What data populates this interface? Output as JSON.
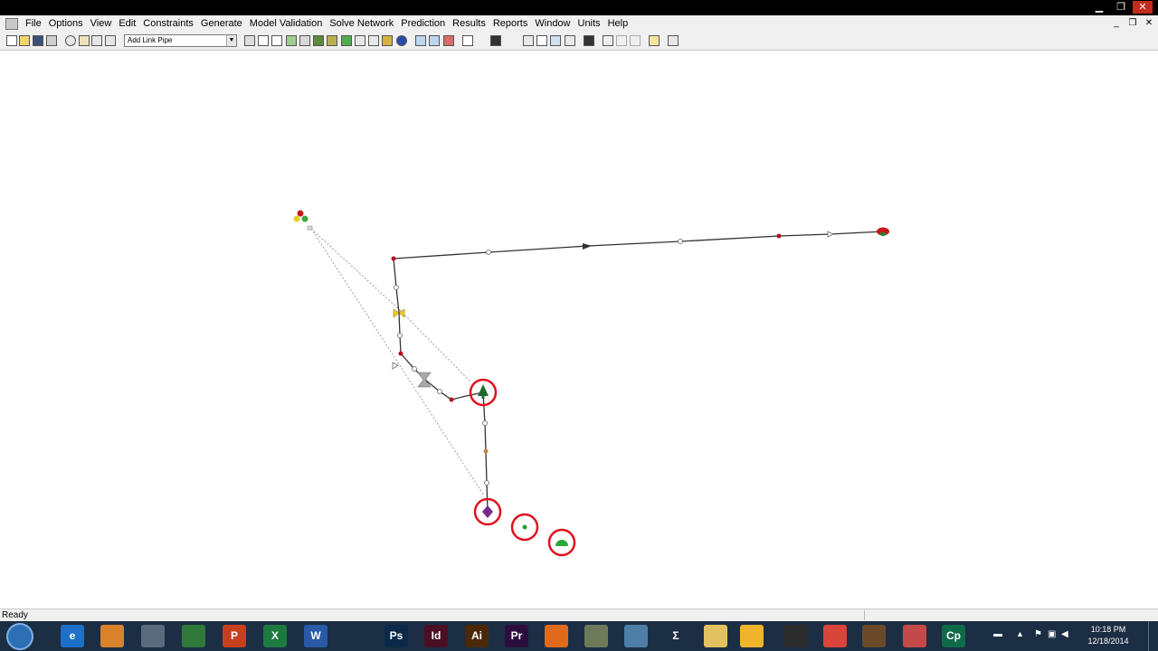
{
  "menu": {
    "items": [
      "File",
      "Options",
      "View",
      "Edit",
      "Constraints",
      "Generate",
      "Model Validation",
      "Solve Network",
      "Prediction",
      "Results",
      "Reports",
      "Window",
      "Units",
      "Help"
    ]
  },
  "toolbar": {
    "link_type": "Add Link Pipe"
  },
  "status": {
    "text": "Ready"
  },
  "taskbar": {
    "apps": [
      {
        "name": "internet-explorer",
        "label": "e",
        "color": "#1e6fc7"
      },
      {
        "name": "file-app",
        "label": "",
        "color": "#d9822b"
      },
      {
        "name": "tools",
        "label": "",
        "color": "#5a6b7d"
      },
      {
        "name": "network-app",
        "label": "",
        "color": "#2f7a3a"
      },
      {
        "name": "powerpoint",
        "label": "P",
        "color": "#c6401f"
      },
      {
        "name": "excel",
        "label": "X",
        "color": "#1d7a3f"
      },
      {
        "name": "word",
        "label": "W",
        "color": "#2a5aa7"
      },
      {
        "name": "moon-app",
        "label": "",
        "color": "#1c2e44"
      },
      {
        "name": "photoshop",
        "label": "Ps",
        "color": "#0b2a4a"
      },
      {
        "name": "indesign",
        "label": "Id",
        "color": "#4a0f24"
      },
      {
        "name": "illustrator",
        "label": "Ai",
        "color": "#4a2a06"
      },
      {
        "name": "premiere",
        "label": "Pr",
        "color": "#2c0e3e"
      },
      {
        "name": "firefox",
        "label": "",
        "color": "#e06a1b"
      },
      {
        "name": "app-diamond",
        "label": "",
        "color": "#6c7a5a"
      },
      {
        "name": "app-book",
        "label": "",
        "color": "#4f7fa8"
      },
      {
        "name": "sigma-app",
        "label": "Σ",
        "color": "#1c2e44"
      },
      {
        "name": "folder",
        "label": "",
        "color": "#e2c160"
      },
      {
        "name": "app-yellow",
        "label": "",
        "color": "#f0b42a"
      },
      {
        "name": "app-keyboard",
        "label": "",
        "color": "#2b2b2b"
      },
      {
        "name": "chrome",
        "label": "",
        "color": "#d9453a"
      },
      {
        "name": "app-game",
        "label": "",
        "color": "#6b4a2a"
      },
      {
        "name": "pipe-app-active",
        "label": "",
        "color": "#c44a4a"
      },
      {
        "name": "captivate",
        "label": "Cp",
        "color": "#0f6a4a"
      }
    ],
    "clock_time": "10:18 PM",
    "clock_date": "12/18/2014"
  },
  "colors": {
    "selection_ring": "#e0101f",
    "pipe": "#333333",
    "junction": "#b01020"
  }
}
